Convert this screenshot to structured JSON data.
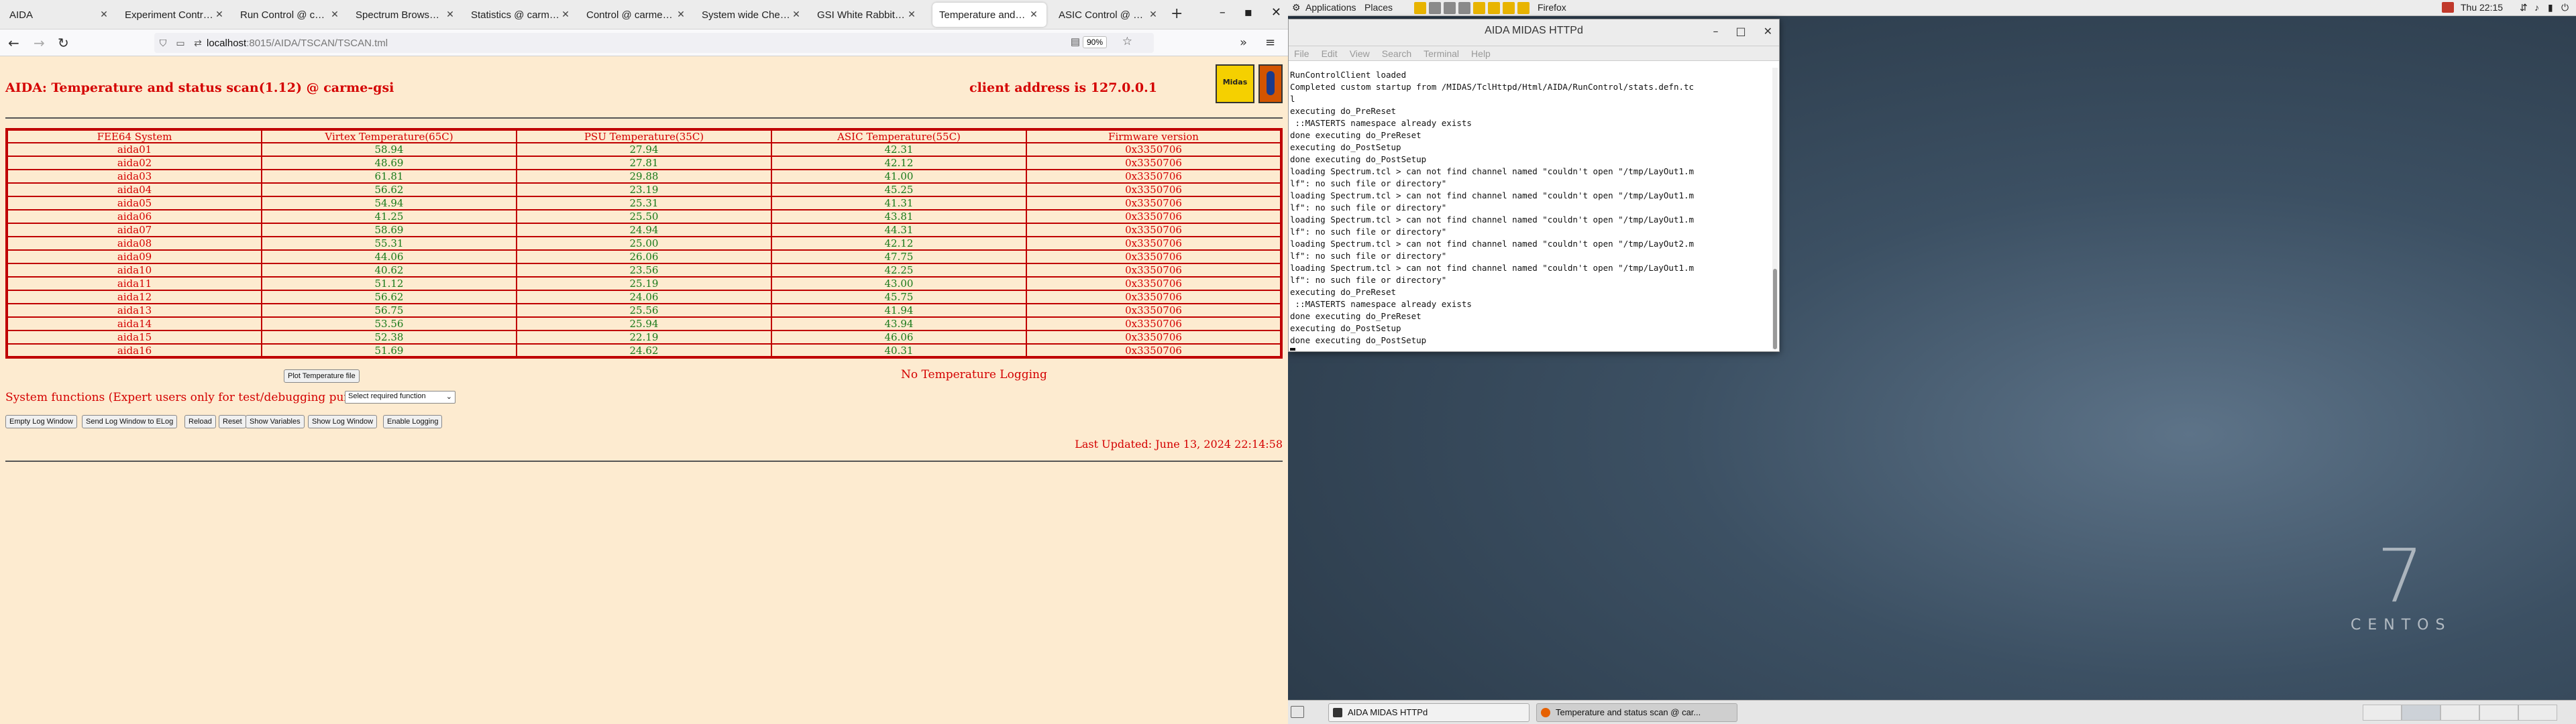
{
  "browser": {
    "tabs": [
      {
        "label": "AIDA",
        "active": false
      },
      {
        "label": "Experiment Control @",
        "active": false
      },
      {
        "label": "Run Control @ carme-",
        "active": false
      },
      {
        "label": "Spectrum Browser @",
        "active": false
      },
      {
        "label": "Statistics @ carme-gs",
        "active": false
      },
      {
        "label": "Control @ carme-gsi",
        "active": false
      },
      {
        "label": "System wide Checks",
        "active": false
      },
      {
        "label": "GSI White Rabbit Tim",
        "active": false
      },
      {
        "label": "Temperature and stat",
        "active": true
      },
      {
        "label": "ASIC Control @ carm",
        "active": false
      }
    ],
    "new_tab": "+",
    "url_host": "localhost",
    "url_path": ":8015/AIDA/TSCAN/TSCAN.tml",
    "zoom": "90%"
  },
  "page": {
    "title": "AIDA: Temperature and status scan(1.12) @ carme-gsi",
    "client_address": "client address is 127.0.0.1",
    "logo_text": "Midas",
    "table": {
      "headers": [
        "FEE64 System",
        "Virtex Temperature(65C)",
        "PSU Temperature(35C)",
        "ASIC Temperature(55C)",
        "Firmware version"
      ],
      "rows": [
        [
          "aida01",
          "58.94",
          "27.94",
          "42.31",
          "0x3350706"
        ],
        [
          "aida02",
          "48.69",
          "27.81",
          "42.12",
          "0x3350706"
        ],
        [
          "aida03",
          "61.81",
          "29.88",
          "41.00",
          "0x3350706"
        ],
        [
          "aida04",
          "56.62",
          "23.19",
          "45.25",
          "0x3350706"
        ],
        [
          "aida05",
          "54.94",
          "25.31",
          "41.31",
          "0x3350706"
        ],
        [
          "aida06",
          "41.25",
          "25.50",
          "43.81",
          "0x3350706"
        ],
        [
          "aida07",
          "58.69",
          "24.94",
          "44.31",
          "0x3350706"
        ],
        [
          "aida08",
          "55.31",
          "25.00",
          "42.12",
          "0x3350706"
        ],
        [
          "aida09",
          "44.06",
          "26.06",
          "47.75",
          "0x3350706"
        ],
        [
          "aida10",
          "40.62",
          "23.56",
          "42.25",
          "0x3350706"
        ],
        [
          "aida11",
          "51.12",
          "25.19",
          "43.00",
          "0x3350706"
        ],
        [
          "aida12",
          "56.62",
          "24.06",
          "45.75",
          "0x3350706"
        ],
        [
          "aida13",
          "56.75",
          "25.56",
          "41.94",
          "0x3350706"
        ],
        [
          "aida14",
          "53.56",
          "25.94",
          "43.94",
          "0x3350706"
        ],
        [
          "aida15",
          "52.38",
          "22.19",
          "46.06",
          "0x3350706"
        ],
        [
          "aida16",
          "51.69",
          "24.62",
          "40.31",
          "0x3350706"
        ]
      ]
    },
    "plot_button": "Plot Temperature file",
    "no_logging": "No Temperature Logging",
    "system_functions": "System functions (Expert users only for test/debugging purposes!!!)",
    "select_function": "Select required function",
    "buttons": [
      "Empty Log Window",
      "Send Log Window to ELog",
      "Reload",
      "Reset",
      "Show Variables",
      "Show Log Window",
      "Enable Logging"
    ],
    "last_updated": "Last Updated: June 13, 2024 22:14:58"
  },
  "desktop": {
    "topbar": {
      "applications": "Applications",
      "places": "Places",
      "firefox": "Firefox",
      "clock": "Thu 22:15"
    },
    "terminal": {
      "title": "AIDA MIDAS HTTPd",
      "menu": [
        "File",
        "Edit",
        "View",
        "Search",
        "Terminal",
        "Help"
      ],
      "lines": [
        "RunControlClient loaded",
        "Completed custom startup from /MIDAS/TclHttpd/Html/AIDA/RunControl/stats.defn.tc",
        "l",
        "executing do_PreReset",
        " ::MASTERTS namespace already exists",
        "done executing do_PreReset",
        "executing do_PostSetup",
        "done executing do_PostSetup",
        "loading Spectrum.tcl > can not find channel named \"couldn't open \"/tmp/LayOut1.m",
        "lf\": no such file or directory\"",
        "loading Spectrum.tcl > can not find channel named \"couldn't open \"/tmp/LayOut1.m",
        "lf\": no such file or directory\"",
        "loading Spectrum.tcl > can not find channel named \"couldn't open \"/tmp/LayOut1.m",
        "lf\": no such file or directory\"",
        "loading Spectrum.tcl > can not find channel named \"couldn't open \"/tmp/LayOut2.m",
        "lf\": no such file or directory\"",
        "loading Spectrum.tcl > can not find channel named \"couldn't open \"/tmp/LayOut1.m",
        "lf\": no such file or directory\"",
        "executing do_PreReset",
        " ::MASTERTS namespace already exists",
        "done executing do_PreReset",
        "executing do_PostSetup",
        "done executing do_PostSetup"
      ]
    },
    "centos_numeral": "7",
    "centos_word": "CENTOS",
    "taskbar": [
      {
        "label": "AIDA MIDAS HTTPd",
        "active": false
      },
      {
        "label": "Temperature and status scan @ car...",
        "active": true
      }
    ]
  }
}
